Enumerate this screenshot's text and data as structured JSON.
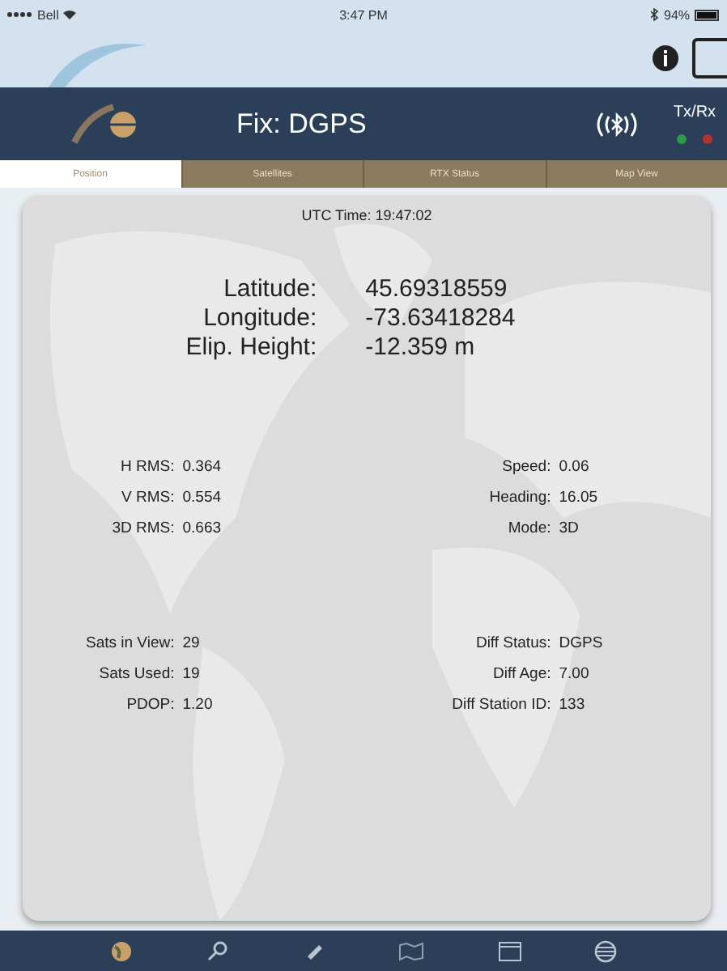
{
  "status_bar": {
    "carrier": "Bell",
    "time": "3:47 PM",
    "battery": "94%"
  },
  "header": {
    "fix": "Fix: DGPS",
    "txrx_label": "Tx/Rx",
    "leds": [
      {
        "color": "#2f9a4c"
      },
      {
        "color": "#b3322e"
      }
    ]
  },
  "tabs": [
    {
      "label": "Position",
      "selected": true
    },
    {
      "label": "Satellites",
      "selected": false
    },
    {
      "label": "RTX Status",
      "selected": false
    },
    {
      "label": "Map View",
      "selected": false
    }
  ],
  "utc_time": "UTC Time: 19:47:02",
  "coordinates": [
    {
      "label": "Latitude:",
      "value": "45.69318559"
    },
    {
      "label": "Longitude:",
      "value": "-73.63418284"
    },
    {
      "label": "Elip. Height:",
      "value": "-12.359 m"
    }
  ],
  "accuracy": {
    "left": [
      {
        "label": "H RMS:",
        "value": "0.364"
      },
      {
        "label": "V RMS:",
        "value": "0.554"
      },
      {
        "label": "3D RMS:",
        "value": "0.663"
      }
    ],
    "right": [
      {
        "label": "Speed:",
        "value": "0.06"
      },
      {
        "label": "Heading:",
        "value": "16.05"
      },
      {
        "label": "Mode:",
        "value": "3D"
      }
    ]
  },
  "satellites": {
    "left": [
      {
        "label": "Sats in View:",
        "value": "29"
      },
      {
        "label": "Sats Used:",
        "value": "19"
      },
      {
        "label": "PDOP:",
        "value": "1.20"
      }
    ],
    "right": [
      {
        "label": "Diff Status:",
        "value": "DGPS"
      },
      {
        "label": "Diff Age:",
        "value": "7.00"
      },
      {
        "label": "Diff Station ID:",
        "value": "133"
      }
    ]
  }
}
